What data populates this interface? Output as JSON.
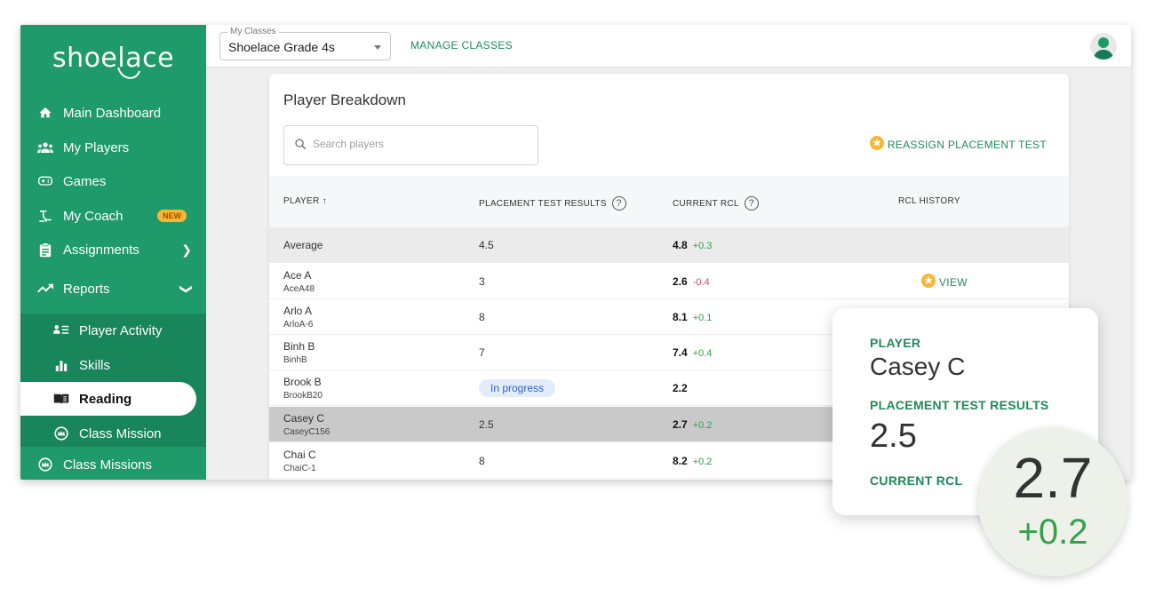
{
  "sidebar": {
    "logo": "shoelace",
    "items": [
      {
        "label": "Main Dashboard",
        "icon": "home-icon"
      },
      {
        "label": "My Players",
        "icon": "group-icon"
      },
      {
        "label": "Games",
        "icon": "gamepad-icon"
      },
      {
        "label": "My Coach",
        "icon": "coach-icon",
        "badge": "NEW"
      },
      {
        "label": "Assignments",
        "icon": "clipboard-icon"
      },
      {
        "label": "Reports",
        "icon": "trending-icon"
      },
      {
        "label": "Player Activity",
        "icon": "list-person-icon"
      },
      {
        "label": "Skills",
        "icon": "bar-chart-icon"
      },
      {
        "label": "Reading",
        "icon": "book-icon",
        "active": true
      },
      {
        "label": "Class Mission",
        "icon": "crown-icon"
      },
      {
        "label": "Class Missions",
        "icon": "crown-icon"
      }
    ]
  },
  "topbar": {
    "class_label": "My Classes",
    "class_value": "Shoelace Grade 4s",
    "manage": "MANAGE CLASSES"
  },
  "card": {
    "title": "Player Breakdown",
    "search_placeholder": "Search players",
    "reassign": "REASSIGN PLACEMENT TEST",
    "headers": {
      "player": "PLAYER ↑",
      "placement": "PLACEMENT TEST RESULTS",
      "rcl": "CURRENT RCL",
      "history": "RCL HISTORY"
    },
    "average": {
      "label": "Average",
      "placement": "4.5",
      "rcl": "4.8",
      "delta": "+0.3"
    },
    "rows": [
      {
        "name": "Ace A",
        "id": "AceA48",
        "placement": "3",
        "rcl": "2.6",
        "delta": "-0.4",
        "view": "VIEW"
      },
      {
        "name": "Arlo A",
        "id": "ArloA-6",
        "placement": "8",
        "rcl": "8.1",
        "delta": "+0.1"
      },
      {
        "name": "Binh B",
        "id": "BinhB",
        "placement": "7",
        "rcl": "7.4",
        "delta": "+0.4"
      },
      {
        "name": "Brook B",
        "id": "BrookB20",
        "placement": "In progress",
        "rcl": "2.2",
        "delta": ""
      },
      {
        "name": "Casey C",
        "id": "CaseyC156",
        "placement": "2.5",
        "rcl": "2.7",
        "delta": "+0.2"
      },
      {
        "name": "Chai C",
        "id": "ChaiC-1",
        "placement": "8",
        "rcl": "8.2",
        "delta": "+0.2"
      }
    ]
  },
  "popup": {
    "player_label": "PLAYER",
    "player_name": "Casey C",
    "placement_label": "PLACEMENT TEST RESULTS",
    "placement_value": "2.5",
    "rcl_label": "CURRENT RCL",
    "rcl_value": "2.7",
    "rcl_delta": "+0.2"
  },
  "colors": {
    "brand": "#1f9a6a",
    "accent": "#1f8a5a",
    "positive": "#2aa44a",
    "negative": "#d1485f",
    "star": "#f7b733"
  }
}
